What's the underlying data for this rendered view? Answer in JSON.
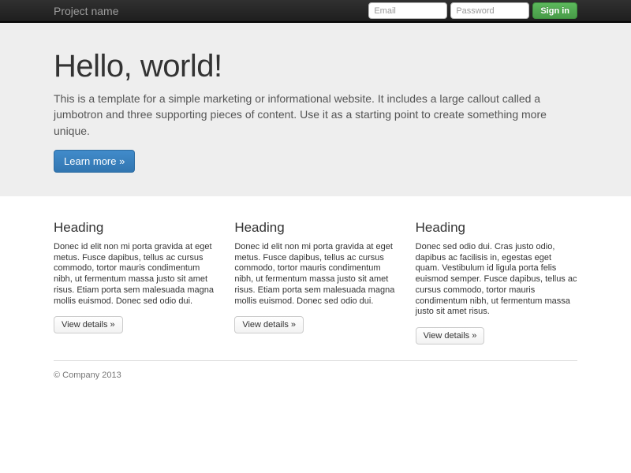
{
  "navbar": {
    "brand": "Project name",
    "form": {
      "email_placeholder": "Email",
      "password_placeholder": "Password",
      "signin_label": "Sign in"
    }
  },
  "jumbotron": {
    "title": "Hello, world!",
    "description": "This is a template for a simple marketing or informational website. It includes a large callout called a jumbotron and three supporting pieces of content. Use it as a starting point to create something more unique.",
    "cta_label": "Learn more »"
  },
  "columns": [
    {
      "heading": "Heading",
      "body": "Donec id elit non mi porta gravida at eget metus. Fusce dapibus, tellus ac cursus commodo, tortor mauris condimentum nibh, ut fermentum massa justo sit amet risus. Etiam porta sem malesuada magna mollis euismod. Donec sed odio dui.",
      "button_label": "View details »"
    },
    {
      "heading": "Heading",
      "body": "Donec id elit non mi porta gravida at eget metus. Fusce dapibus, tellus ac cursus commodo, tortor mauris condimentum nibh, ut fermentum massa justo sit amet risus. Etiam porta sem malesuada magna mollis euismod. Donec sed odio dui.",
      "button_label": "View details »"
    },
    {
      "heading": "Heading",
      "body": "Donec sed odio dui. Cras justo odio, dapibus ac facilisis in, egestas eget quam. Vestibulum id ligula porta felis euismod semper. Fusce dapibus, tellus ac cursus commodo, tortor mauris condimentum nibh, ut fermentum massa justo sit amet risus.",
      "button_label": "View details »"
    }
  ],
  "footer": {
    "copyright": "© Company 2013"
  },
  "colors": {
    "navbar_bg": "#222222",
    "jumbotron_bg": "#eeeeee",
    "primary_blue": "#418bca",
    "success_green": "#5cb85c"
  }
}
